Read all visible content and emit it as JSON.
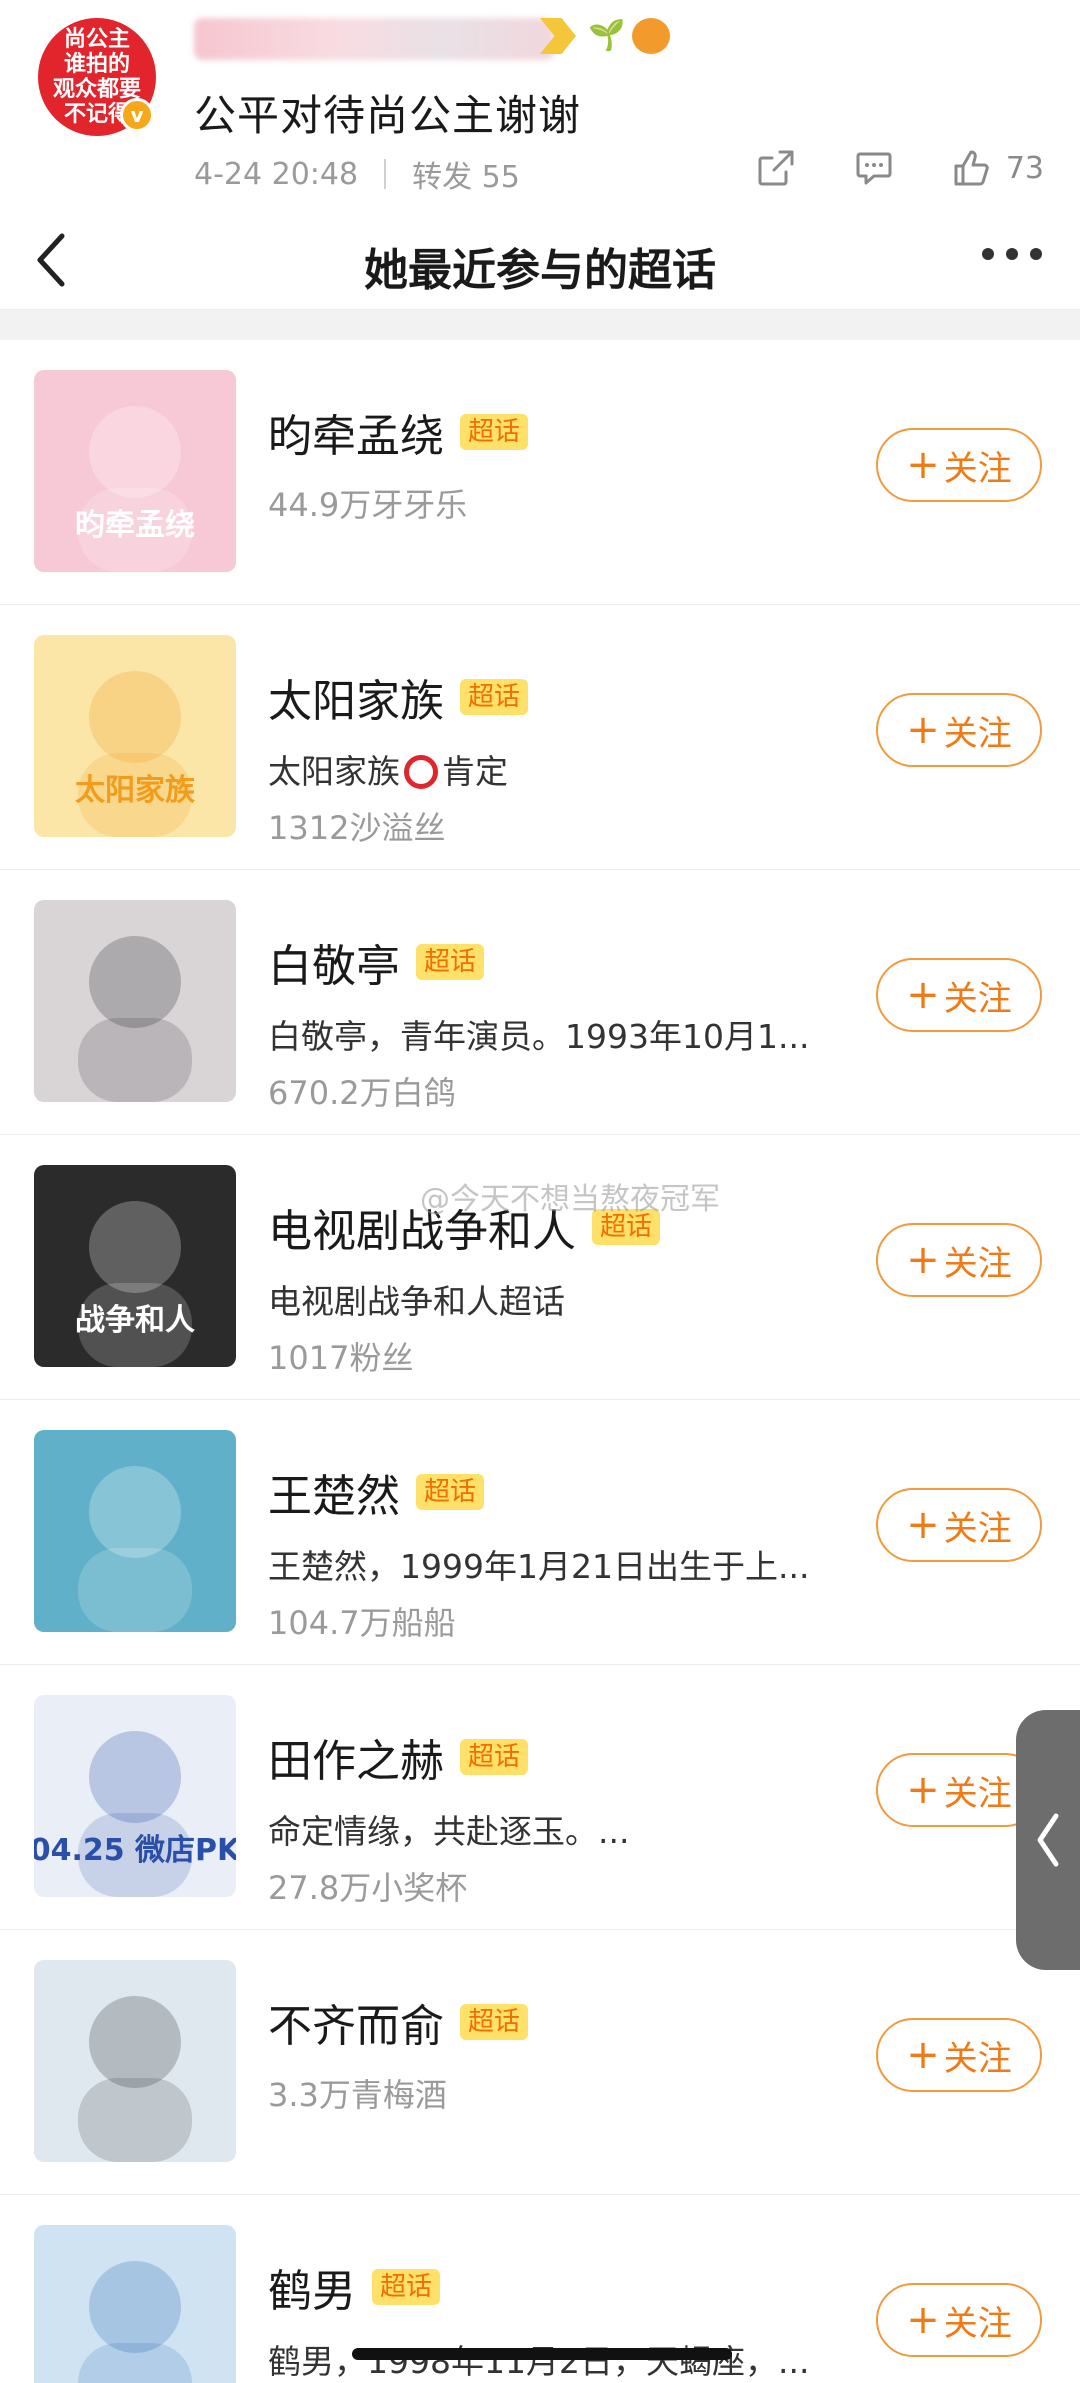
{
  "post": {
    "avatar_text": "尚公主\n谁拍的\n观众都要\n不记得",
    "avatar_badge": "v",
    "text": "公平对待尚公主谢谢",
    "date": "4-24 20:48",
    "repost": "转发 55",
    "like_count": "73"
  },
  "sheet": {
    "title": "她最近参与的超话"
  },
  "tag_label": "超话",
  "follow_label": "关注",
  "watermark": "@今天不想当熬夜冠军",
  "items": [
    {
      "name": "昀牵孟绕",
      "desc": "",
      "fans": "44.9万牙牙乐",
      "thumb_bg": "#f7c9d6",
      "thumb_fg": "#ffffff",
      "thumb_text": "昀牵孟绕"
    },
    {
      "name": "太阳家族",
      "desc": "太阳家族",
      "desc_suffix": "肯定",
      "fans": "1312沙溢丝",
      "thumb_bg": "#fbe6a8",
      "thumb_fg": "#f39c1c",
      "thumb_text": "太阳家族"
    },
    {
      "name": "白敬亭",
      "desc": "白敬亭，青年演员。1993年10月1...",
      "fans": "670.2万白鸽",
      "thumb_bg": "#d9d4d6",
      "thumb_fg": "#2a2a33",
      "thumb_text": ""
    },
    {
      "name": "电视剧战争和人",
      "desc": "电视剧战争和人超话",
      "fans": "1017粉丝",
      "thumb_bg": "#2b2b2b",
      "thumb_fg": "#ffffff",
      "thumb_text": "战争和人"
    },
    {
      "name": "王楚然",
      "desc": "王楚然，1999年1月21日出生于上...",
      "fans": "104.7万船船",
      "thumb_bg": "#5fb0c8",
      "thumb_fg": "#ffffff",
      "thumb_text": ""
    },
    {
      "name": "田作之赫",
      "desc": "命定情缘，共赴逐玉。...",
      "fans": "27.8万小奖杯",
      "thumb_bg": "#e9eef7",
      "thumb_fg": "#2a4fa8",
      "thumb_text": "04.25 微店PK"
    },
    {
      "name": "不齐而俞",
      "desc": "",
      "fans": "3.3万青梅酒",
      "thumb_bg": "#dfe8ef",
      "thumb_fg": "#333333",
      "thumb_text": ""
    },
    {
      "name": "鹤男",
      "desc": "鹤男，1998年11月2日，天蝎座，...",
      "fans": "",
      "thumb_bg": "#cfe3f3",
      "thumb_fg": "#2b6cb0",
      "thumb_text": ""
    }
  ],
  "colors": {
    "accent": "#f07a16",
    "tag_bg": "#ffe169",
    "avatar_bg": "#e2242c"
  }
}
